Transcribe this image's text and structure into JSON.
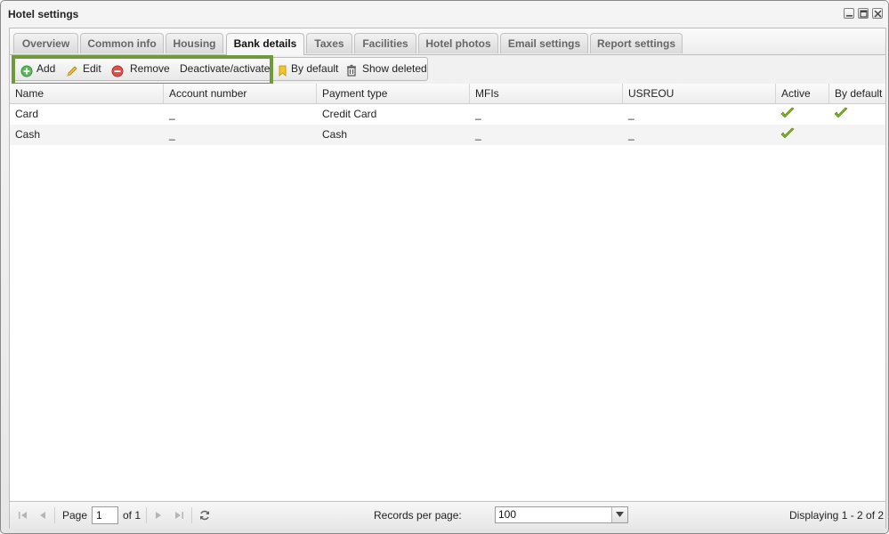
{
  "window": {
    "title": "Hotel settings"
  },
  "tabs": [
    {
      "label": "Overview"
    },
    {
      "label": "Common info"
    },
    {
      "label": "Housing"
    },
    {
      "label": "Bank details"
    },
    {
      "label": "Taxes"
    },
    {
      "label": "Facilities"
    },
    {
      "label": "Hotel photos"
    },
    {
      "label": "Email settings"
    },
    {
      "label": "Report settings"
    }
  ],
  "active_tab": "Bank details",
  "toolbar": {
    "add": "Add",
    "edit": "Edit",
    "remove": "Remove",
    "deactivate": "Deactivate/activate",
    "by_default": "By default",
    "show_deleted": "Show deleted"
  },
  "grid": {
    "columns": [
      "Name",
      "Account number",
      "Payment type",
      "MFIs",
      "USREOU",
      "Active",
      "By default"
    ],
    "rows": [
      {
        "name": "Card",
        "account": "_",
        "payment_type": "Credit Card",
        "mfis": "_",
        "usreou": "_",
        "active": true,
        "by_default": true
      },
      {
        "name": "Cash",
        "account": "_",
        "payment_type": "Cash",
        "mfis": "_",
        "usreou": "_",
        "active": true,
        "by_default": false
      }
    ]
  },
  "pager": {
    "page_label": "Page",
    "page_value": "1",
    "of_label": "of 1",
    "records_label": "Records per page:",
    "records_value": "100",
    "displaying": "Displaying 1 - 2 of 2"
  },
  "colors": {
    "highlight": "#6e9a3a",
    "check": "#7ab51d",
    "remove": "#d9534f",
    "add": "#4caf50"
  }
}
